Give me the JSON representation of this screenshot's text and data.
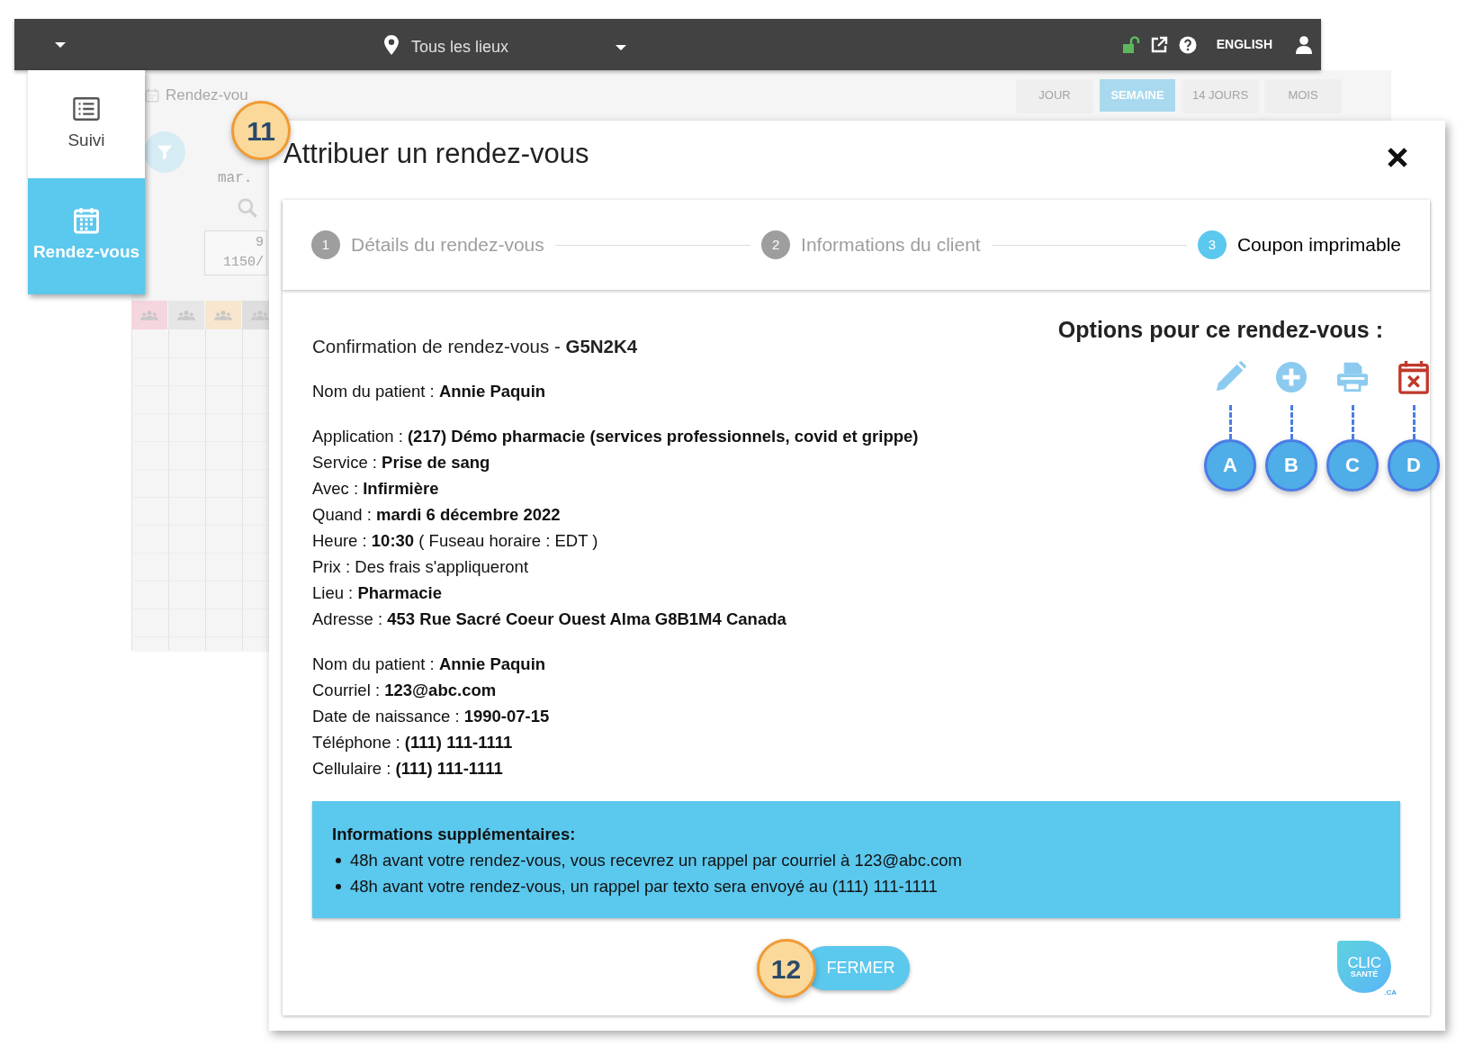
{
  "top_bar": {
    "location_select": "Tous les lieux",
    "language_link": "ENGLISH"
  },
  "sidebar": {
    "items": [
      {
        "label": "Suivi",
        "kind": "list",
        "selected": false
      },
      {
        "label": "Rendez-vous",
        "kind": "calendar",
        "selected": true
      }
    ]
  },
  "background_view": {
    "breadcrumb": "Rendez-vou",
    "view_tabs": [
      {
        "label": "JOUR",
        "selected": false
      },
      {
        "label": "SEMAINE",
        "selected": true
      },
      {
        "label": "14 JOURS",
        "selected": false
      },
      {
        "label": "MOIS",
        "selected": false
      }
    ],
    "day_label": "mar.",
    "count_lines": [
      "9",
      "1150/"
    ],
    "column_headers": [
      {
        "color": "#f6d6de"
      },
      {
        "color": "#e6e6e6"
      },
      {
        "color": "#f8e6cf"
      },
      {
        "color": "#dedede"
      }
    ]
  },
  "dialog": {
    "title": "Attribuer un rendez-vous",
    "steps": [
      {
        "number": "1",
        "label": "Détails du rendez-vous",
        "selected": false
      },
      {
        "number": "2",
        "label": "Informations du client",
        "selected": false
      },
      {
        "number": "3",
        "label": "Coupon imprimable",
        "selected": true
      }
    ],
    "confirmation": "Confirmation de rendez-vous - **G5N2K4**",
    "blocks": [
      [
        "Nom du patient : **Annie Paquin**"
      ],
      [
        "Application : **(217) Démo pharmacie (services professionnels, covid et grippe)**",
        "Service : **Prise de sang**",
        "Avec : **Infirmière**",
        "Quand : **mardi 6 décembre 2022**",
        "Heure : **10:30** ( Fuseau horaire : EDT )",
        "Prix : Des frais s'appliqueront",
        "Lieu : **Pharmacie**",
        "Adresse : **453 Rue Sacré Coeur Ouest Alma G8B1M4 Canada**"
      ],
      [
        "Nom du patient : **Annie Paquin**",
        "Courriel : **123@abc.com**",
        "Date de naissance : **1990-07-15**",
        "Téléphone : **(111) 111-1111**",
        "Cellulaire : **(111) 111-1111**"
      ]
    ],
    "options_title": "Options pour ce rendez-vous :",
    "options": [
      {
        "kind": "edit",
        "callout": "A"
      },
      {
        "kind": "add",
        "callout": "B"
      },
      {
        "kind": "print",
        "callout": "C"
      },
      {
        "kind": "cancel",
        "callout": "D"
      }
    ],
    "info_box": {
      "title": "Informations supplémentaires:",
      "items": [
        "48h avant votre rendez-vous, vous recevrez un rappel par courriel à 123@abc.com",
        "48h avant votre rendez-vous, un rappel par texto sera envoyé au (111) 111-1111"
      ]
    },
    "close_button": "FERMER",
    "logo": {
      "line_1": "CLIC",
      "line_2": "SANTÉ",
      "suffix": ".CA"
    }
  },
  "callouts": [
    "11",
    "12"
  ]
}
